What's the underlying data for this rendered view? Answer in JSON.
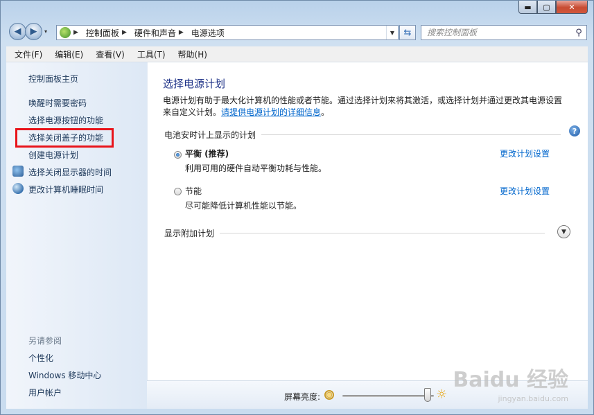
{
  "window": {
    "controls": {
      "minimize": "▬",
      "maximize": "▢",
      "close": "✕"
    }
  },
  "nav": {
    "back": "◀",
    "forward": "▶",
    "dropdown": "▾"
  },
  "address": {
    "crumbs": [
      "控制面板",
      "硬件和声音",
      "电源选项"
    ]
  },
  "search": {
    "placeholder": "搜索控制面板"
  },
  "menu": [
    "文件(F)",
    "编辑(E)",
    "查看(V)",
    "工具(T)",
    "帮助(H)"
  ],
  "sidebar": {
    "items": [
      {
        "label": "控制面板主页"
      },
      {
        "label": "唤醒时需要密码"
      },
      {
        "label": "选择电源按钮的功能"
      },
      {
        "label": "选择关闭盖子的功能"
      },
      {
        "label": "创建电源计划"
      },
      {
        "label": "选择关闭显示器的时间"
      },
      {
        "label": "更改计算机睡眠时间"
      }
    ],
    "see_also_title": "另请参阅",
    "see_also": [
      {
        "label": "个性化"
      },
      {
        "label": "Windows 移动中心"
      },
      {
        "label": "用户帐户"
      }
    ]
  },
  "main": {
    "title": "选择电源计划",
    "description": "电源计划有助于最大化计算机的性能或者节能。通过选择计划来将其激活，或选择计划并通过更改其电源设置来自定义计划。",
    "description_link": "请提供电源计划的详细信息",
    "description_end": "。",
    "battery_group": "电池安时计上显示的计划",
    "plans": [
      {
        "name": "平衡 (推荐)",
        "desc": "利用可用的硬件自动平衡功耗与性能。",
        "link": "更改计划设置",
        "selected": true
      },
      {
        "name": "节能",
        "desc": "尽可能降低计算机性能以节能。",
        "link": "更改计划设置",
        "selected": false
      }
    ],
    "additional": "显示附加计划"
  },
  "brightness": {
    "label": "屏幕亮度:",
    "level": 0.93
  },
  "help": "?",
  "watermark": {
    "text": "Baidu 经验",
    "sub": "jingyan.baidu.com"
  }
}
